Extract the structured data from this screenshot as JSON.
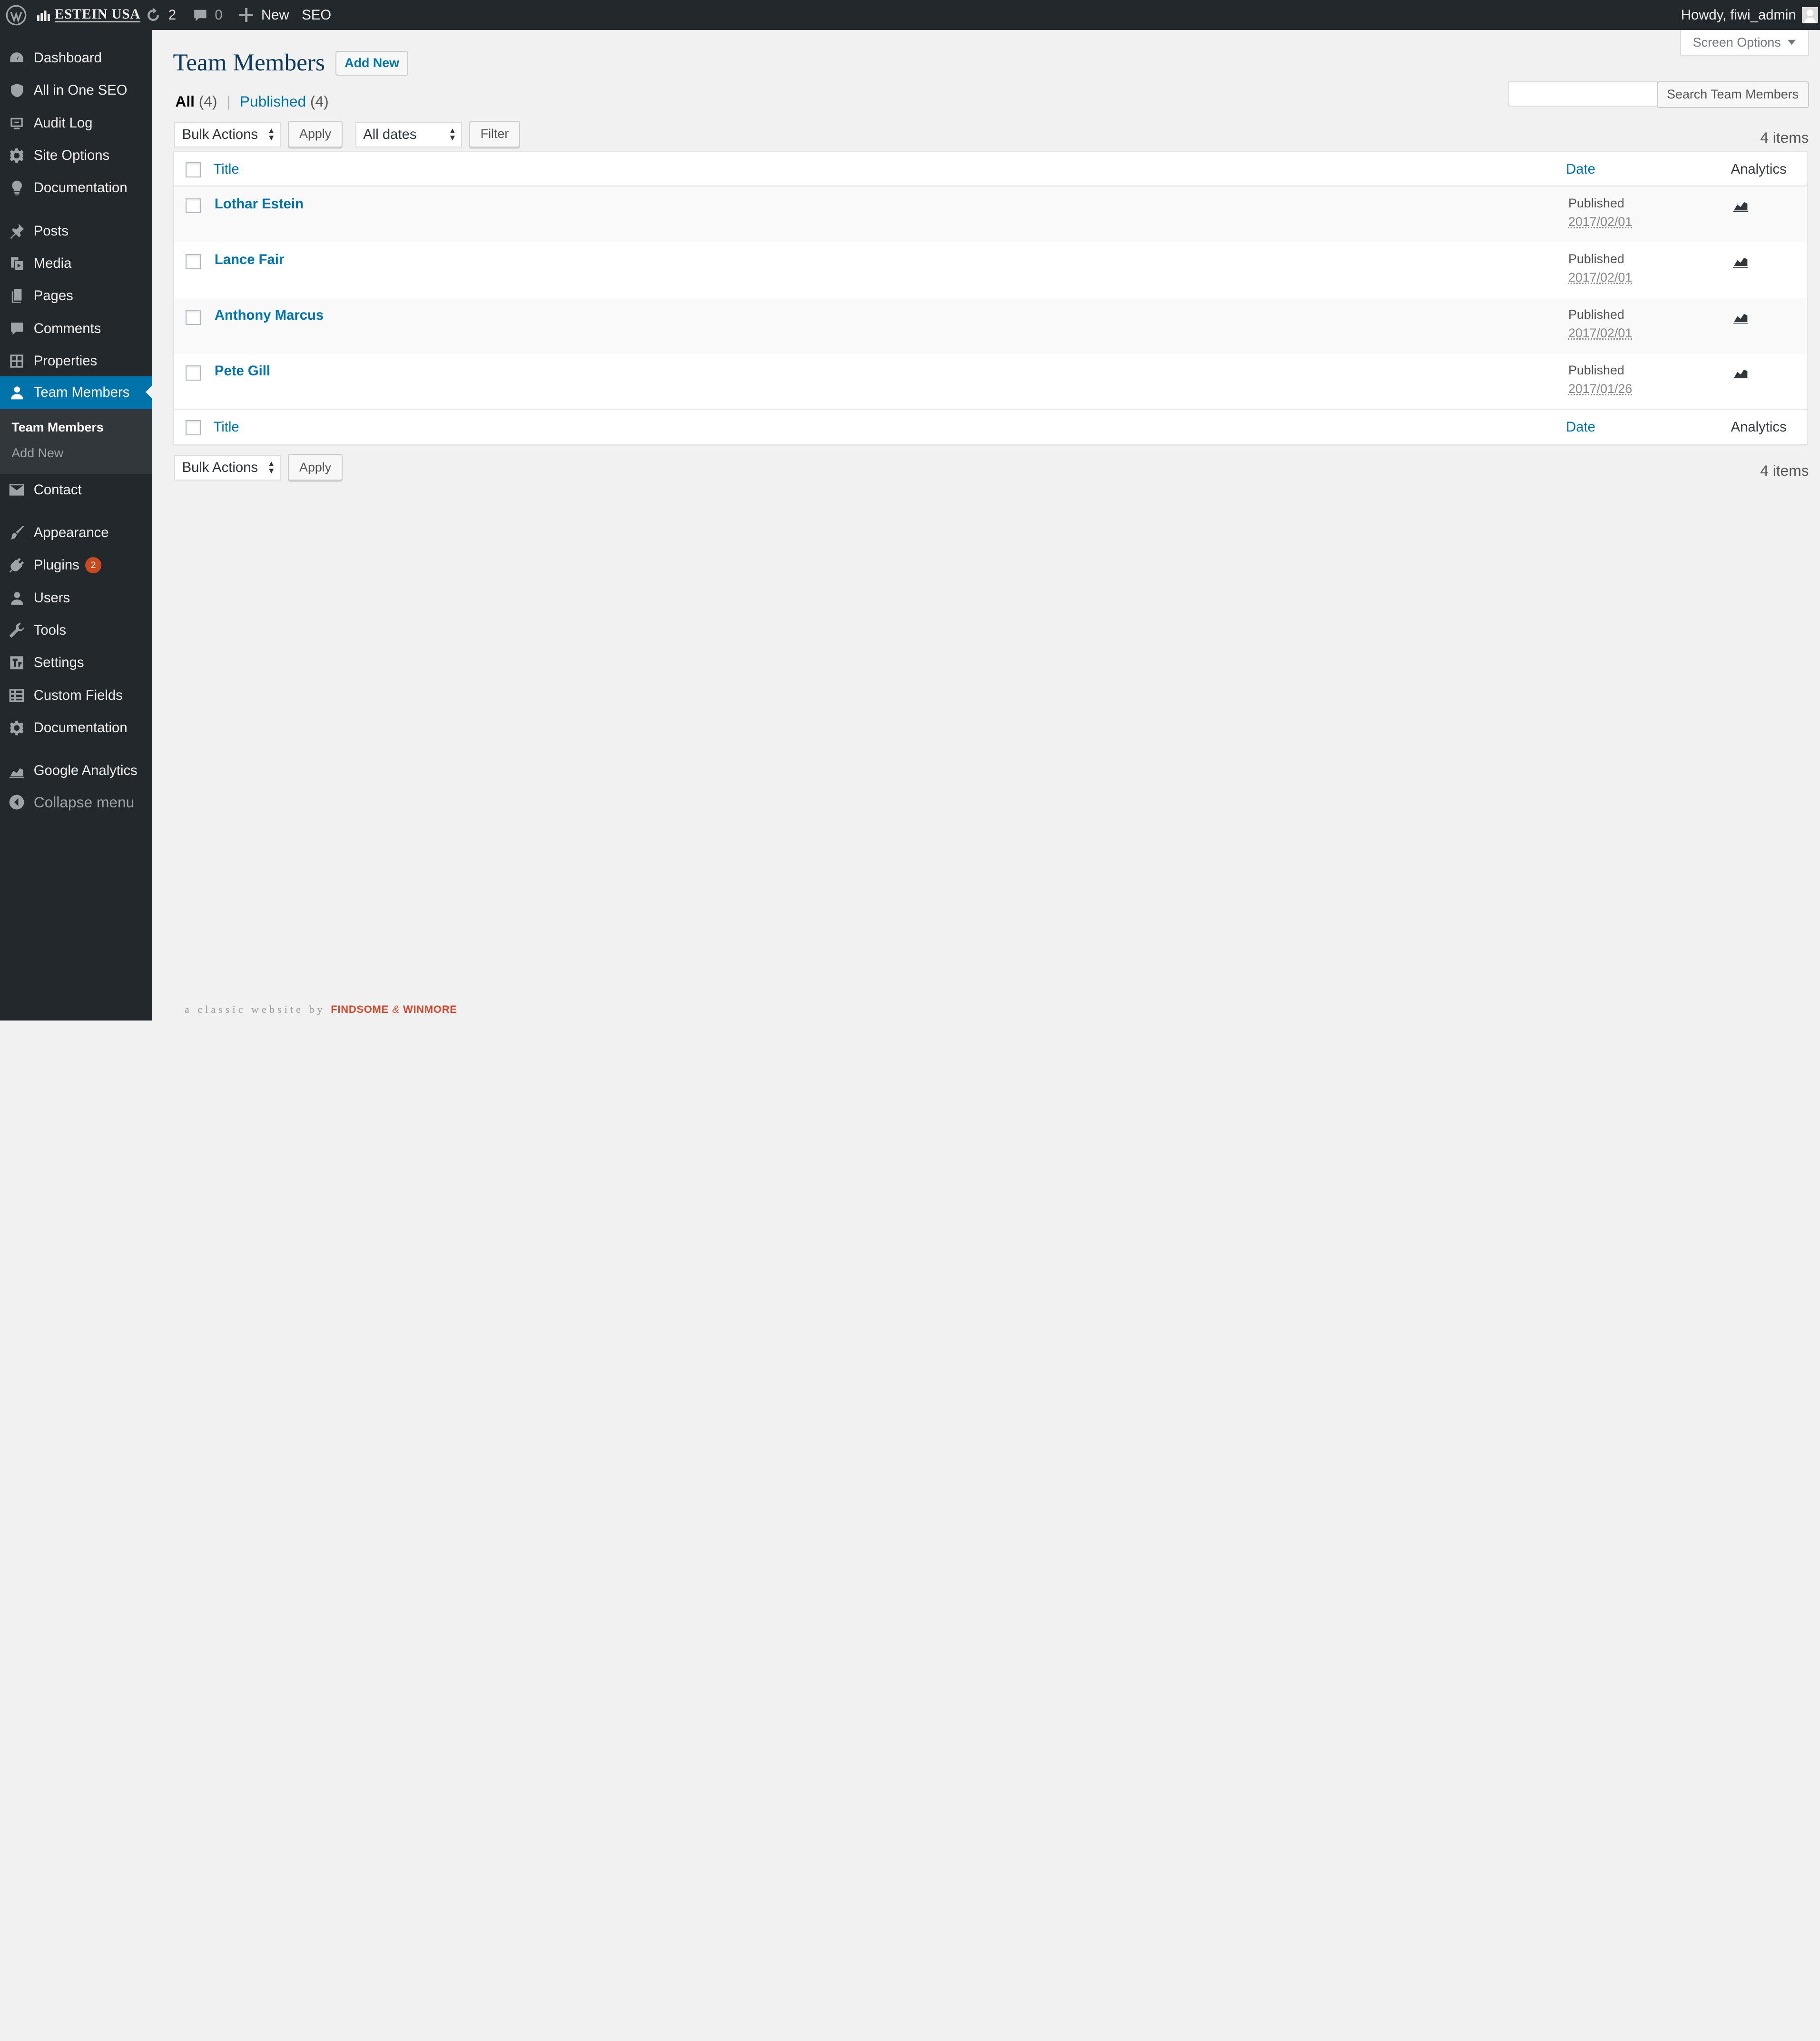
{
  "adminbar": {
    "site_name": "ESTEIN USA",
    "updates_count": "2",
    "comments_count": "0",
    "new_label": "New",
    "seo_label": "SEO",
    "howdy": "Howdy, fiwi_admin"
  },
  "sidebar": {
    "items": [
      {
        "label": "Dashboard",
        "icon": "dashboard-icon"
      },
      {
        "label": "All in One SEO",
        "icon": "shield-icon"
      },
      {
        "label": "Audit Log",
        "icon": "audit-log-icon"
      },
      {
        "label": "Site Options",
        "icon": "gear-icon"
      },
      {
        "label": "Documentation",
        "icon": "lightbulb-icon"
      },
      {
        "label": "Posts",
        "icon": "pin-icon"
      },
      {
        "label": "Media",
        "icon": "media-icon"
      },
      {
        "label": "Pages",
        "icon": "pages-icon"
      },
      {
        "label": "Comments",
        "icon": "comment-icon"
      },
      {
        "label": "Properties",
        "icon": "grid-icon"
      },
      {
        "label": "Team Members",
        "icon": "user-icon"
      },
      {
        "label": "Contact",
        "icon": "mail-icon"
      },
      {
        "label": "Appearance",
        "icon": "brush-icon"
      },
      {
        "label": "Plugins",
        "icon": "plugin-icon",
        "badge": "2"
      },
      {
        "label": "Users",
        "icon": "users-icon"
      },
      {
        "label": "Tools",
        "icon": "wrench-icon"
      },
      {
        "label": "Settings",
        "icon": "settings-icon"
      },
      {
        "label": "Custom Fields",
        "icon": "table-icon"
      },
      {
        "label": "Documentation",
        "icon": "gear-icon"
      },
      {
        "label": "Google Analytics",
        "icon": "analytics-icon"
      }
    ],
    "submenu": {
      "current": "Team Members",
      "add_new": "Add New"
    },
    "collapse": "Collapse menu"
  },
  "header": {
    "title": "Team Members",
    "add_new": "Add New",
    "screen_options": "Screen Options"
  },
  "filters": {
    "all_label": "All",
    "all_count": "(4)",
    "separator": "|",
    "published_label": "Published",
    "published_count": "(4)",
    "bulk_actions": "Bulk Actions",
    "apply": "Apply",
    "all_dates": "All dates",
    "filter": "Filter",
    "search_button": "Search Team Members",
    "items_count": "4 items"
  },
  "table": {
    "columns": {
      "title": "Title",
      "date": "Date",
      "analytics": "Analytics"
    },
    "rows": [
      {
        "name": "Lothar Estein",
        "status": "Published",
        "date": "2017/02/01"
      },
      {
        "name": "Lance Fair",
        "status": "Published",
        "date": "2017/02/01"
      },
      {
        "name": "Anthony Marcus",
        "status": "Published",
        "date": "2017/02/01"
      },
      {
        "name": "Pete Gill",
        "status": "Published",
        "date": "2017/01/26"
      }
    ]
  },
  "footer": {
    "prefix": "a classic website by",
    "brand1": "FINDSOME",
    "amp": "&",
    "brand2": "WINMORE"
  },
  "colors": {
    "accent": "#0073aa",
    "adminbar_bg": "#23282d",
    "badge": "#ca4a1f",
    "brand": "#d6482b"
  }
}
